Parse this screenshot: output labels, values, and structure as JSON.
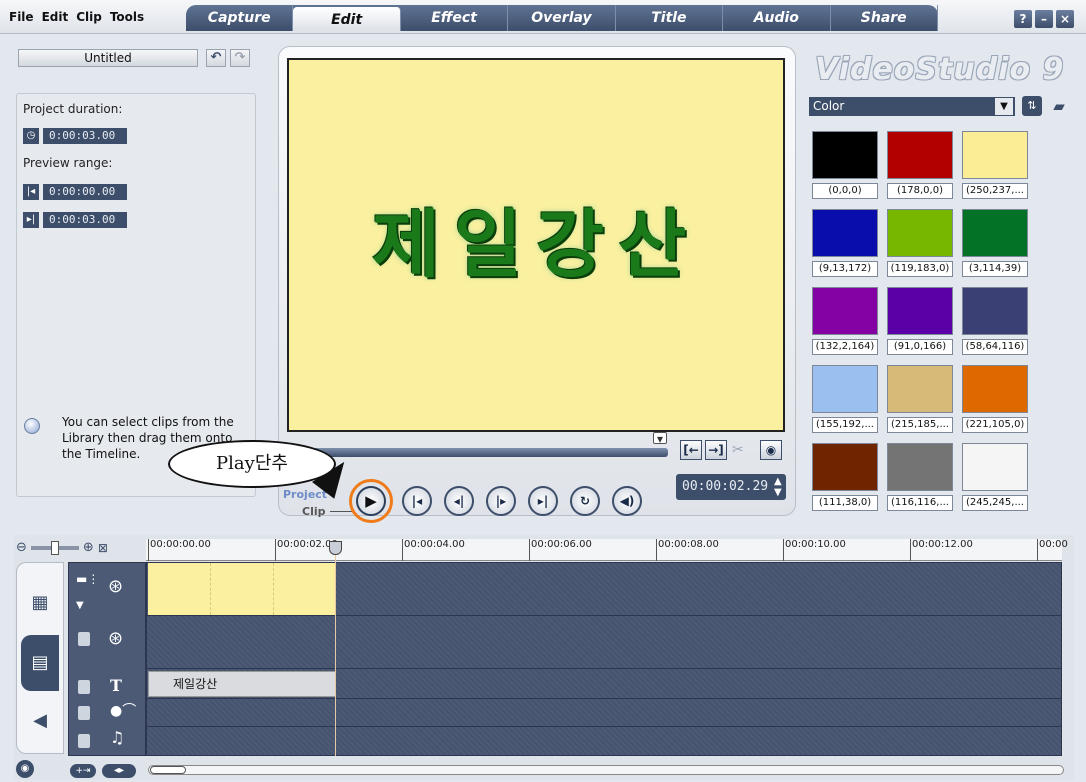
{
  "menu": [
    "File",
    "Edit",
    "Clip",
    "Tools"
  ],
  "tabs": [
    "Capture",
    "Edit",
    "Effect",
    "Overlay",
    "Title",
    "Audio",
    "Share"
  ],
  "active_tab": "Edit",
  "window_buttons": [
    "?",
    "–",
    "×"
  ],
  "project": {
    "title": "Untitled",
    "duration_label": "Project duration:",
    "duration": "0:00:03.00",
    "preview_range_label": "Preview range:",
    "range_start": "0:00:00.00",
    "range_end": "0:00:03.00"
  },
  "hint": "You can select clips from the Library then drag them onto the Timeline.",
  "preview": {
    "text": "제일강산",
    "timecode": "00:00:02.29",
    "project_label": "Project",
    "clip_label": "Clip"
  },
  "annotation": {
    "bubble_text": "Play단추"
  },
  "brand": "VideoStudio 9",
  "library": {
    "selected": "Color",
    "swatches": [
      {
        "label": "(0,0,0)",
        "color": "#000000"
      },
      {
        "label": "(178,0,0)",
        "color": "#b20000"
      },
      {
        "label": "(250,237,...",
        "color": "#faed96"
      },
      {
        "label": "(9,13,172)",
        "color": "#090dac"
      },
      {
        "label": "(119,183,0)",
        "color": "#77b700"
      },
      {
        "label": "(3,114,39)",
        "color": "#037227"
      },
      {
        "label": "(132,2,164)",
        "color": "#8402a4"
      },
      {
        "label": "(91,0,166)",
        "color": "#5b00a6"
      },
      {
        "label": "(58,64,116)",
        "color": "#3a4074"
      },
      {
        "label": "(155,192,...",
        "color": "#9bc0f0"
      },
      {
        "label": "(215,185,...",
        "color": "#d7b978"
      },
      {
        "label": "(221,105,0)",
        "color": "#dd6900"
      },
      {
        "label": "(111,38,0)",
        "color": "#6f2600"
      },
      {
        "label": "(116,116,...",
        "color": "#747474"
      },
      {
        "label": "(245,245,...",
        "color": "#f5f5f5"
      }
    ]
  },
  "timeline": {
    "ticks": [
      "00:00:00.00",
      "00:00:02.00",
      "00:00:04.00",
      "00:00:06.00",
      "00:00:08.00",
      "00:00:10.00",
      "00:00:12.00",
      "00:00"
    ],
    "title_clip": "제일강산"
  },
  "colors": {
    "accent": "#3d4e6b",
    "preview_bg": "#faf0a0",
    "highlight": "#f07b1a"
  }
}
